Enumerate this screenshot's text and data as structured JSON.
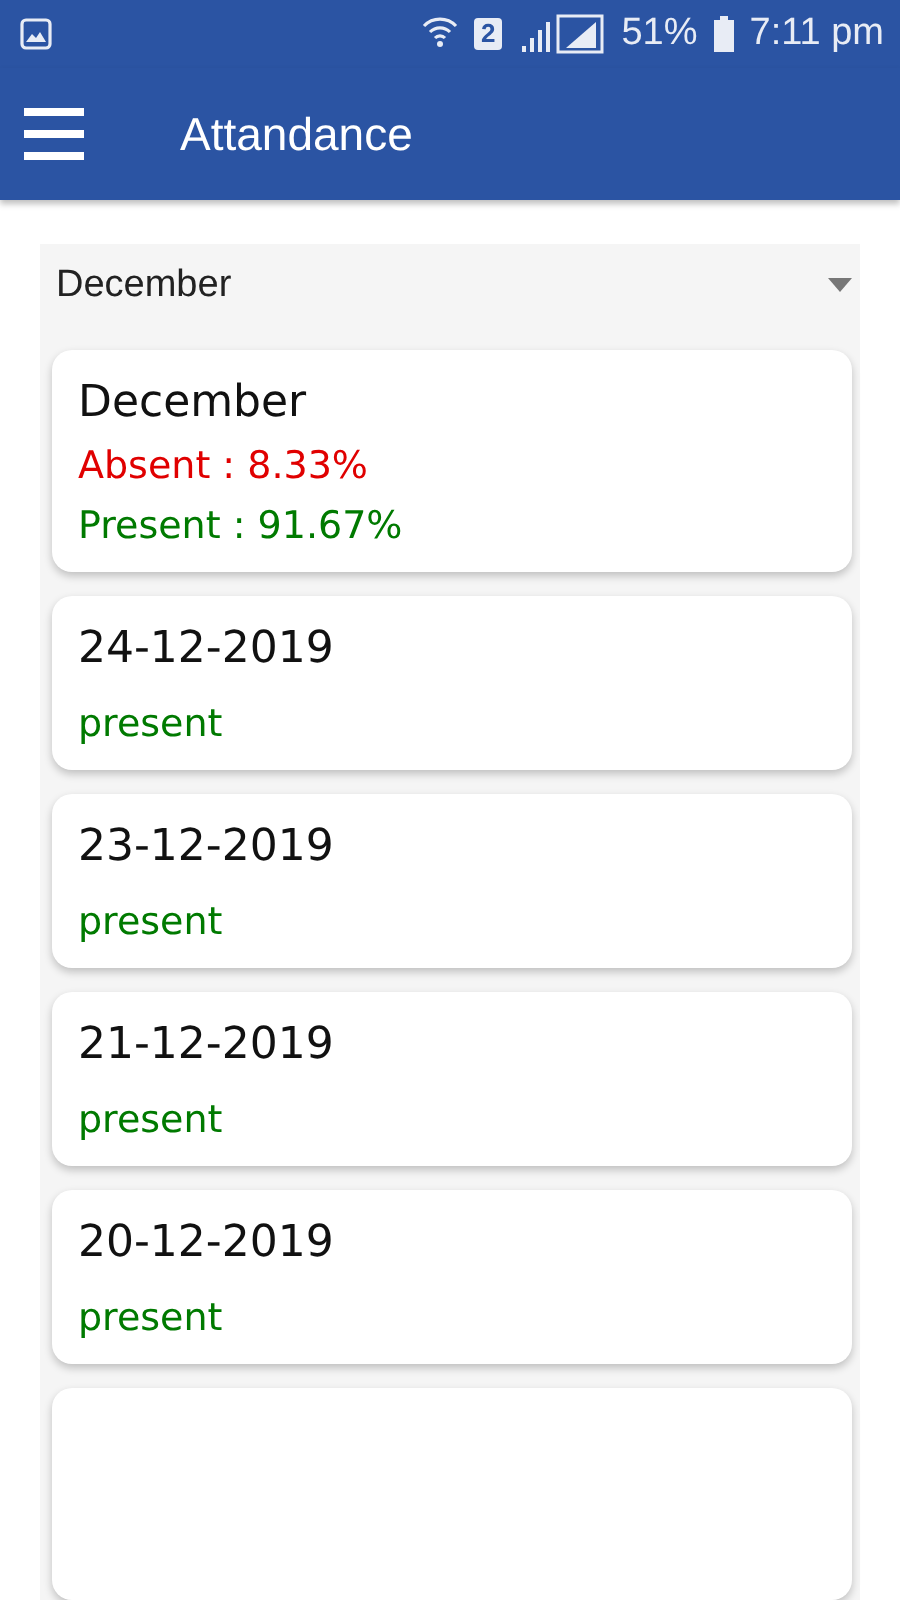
{
  "status_bar": {
    "battery": "51%",
    "time": "7:11 pm",
    "sim": "2"
  },
  "app_bar": {
    "title": "Attandance"
  },
  "month_select": {
    "value": "December"
  },
  "summary": {
    "title": "December",
    "lines": [
      {
        "kind": "absent",
        "text": "Absent : 8.33%"
      },
      {
        "kind": "present",
        "text": "Present : 91.67%"
      }
    ]
  },
  "records": [
    {
      "date": "24-12-2019",
      "kind": "present",
      "status": "present"
    },
    {
      "date": "23-12-2019",
      "kind": "present",
      "status": "present"
    },
    {
      "date": "21-12-2019",
      "kind": "present",
      "status": "present"
    },
    {
      "date": "20-12-2019",
      "kind": "present",
      "status": "present"
    }
  ]
}
